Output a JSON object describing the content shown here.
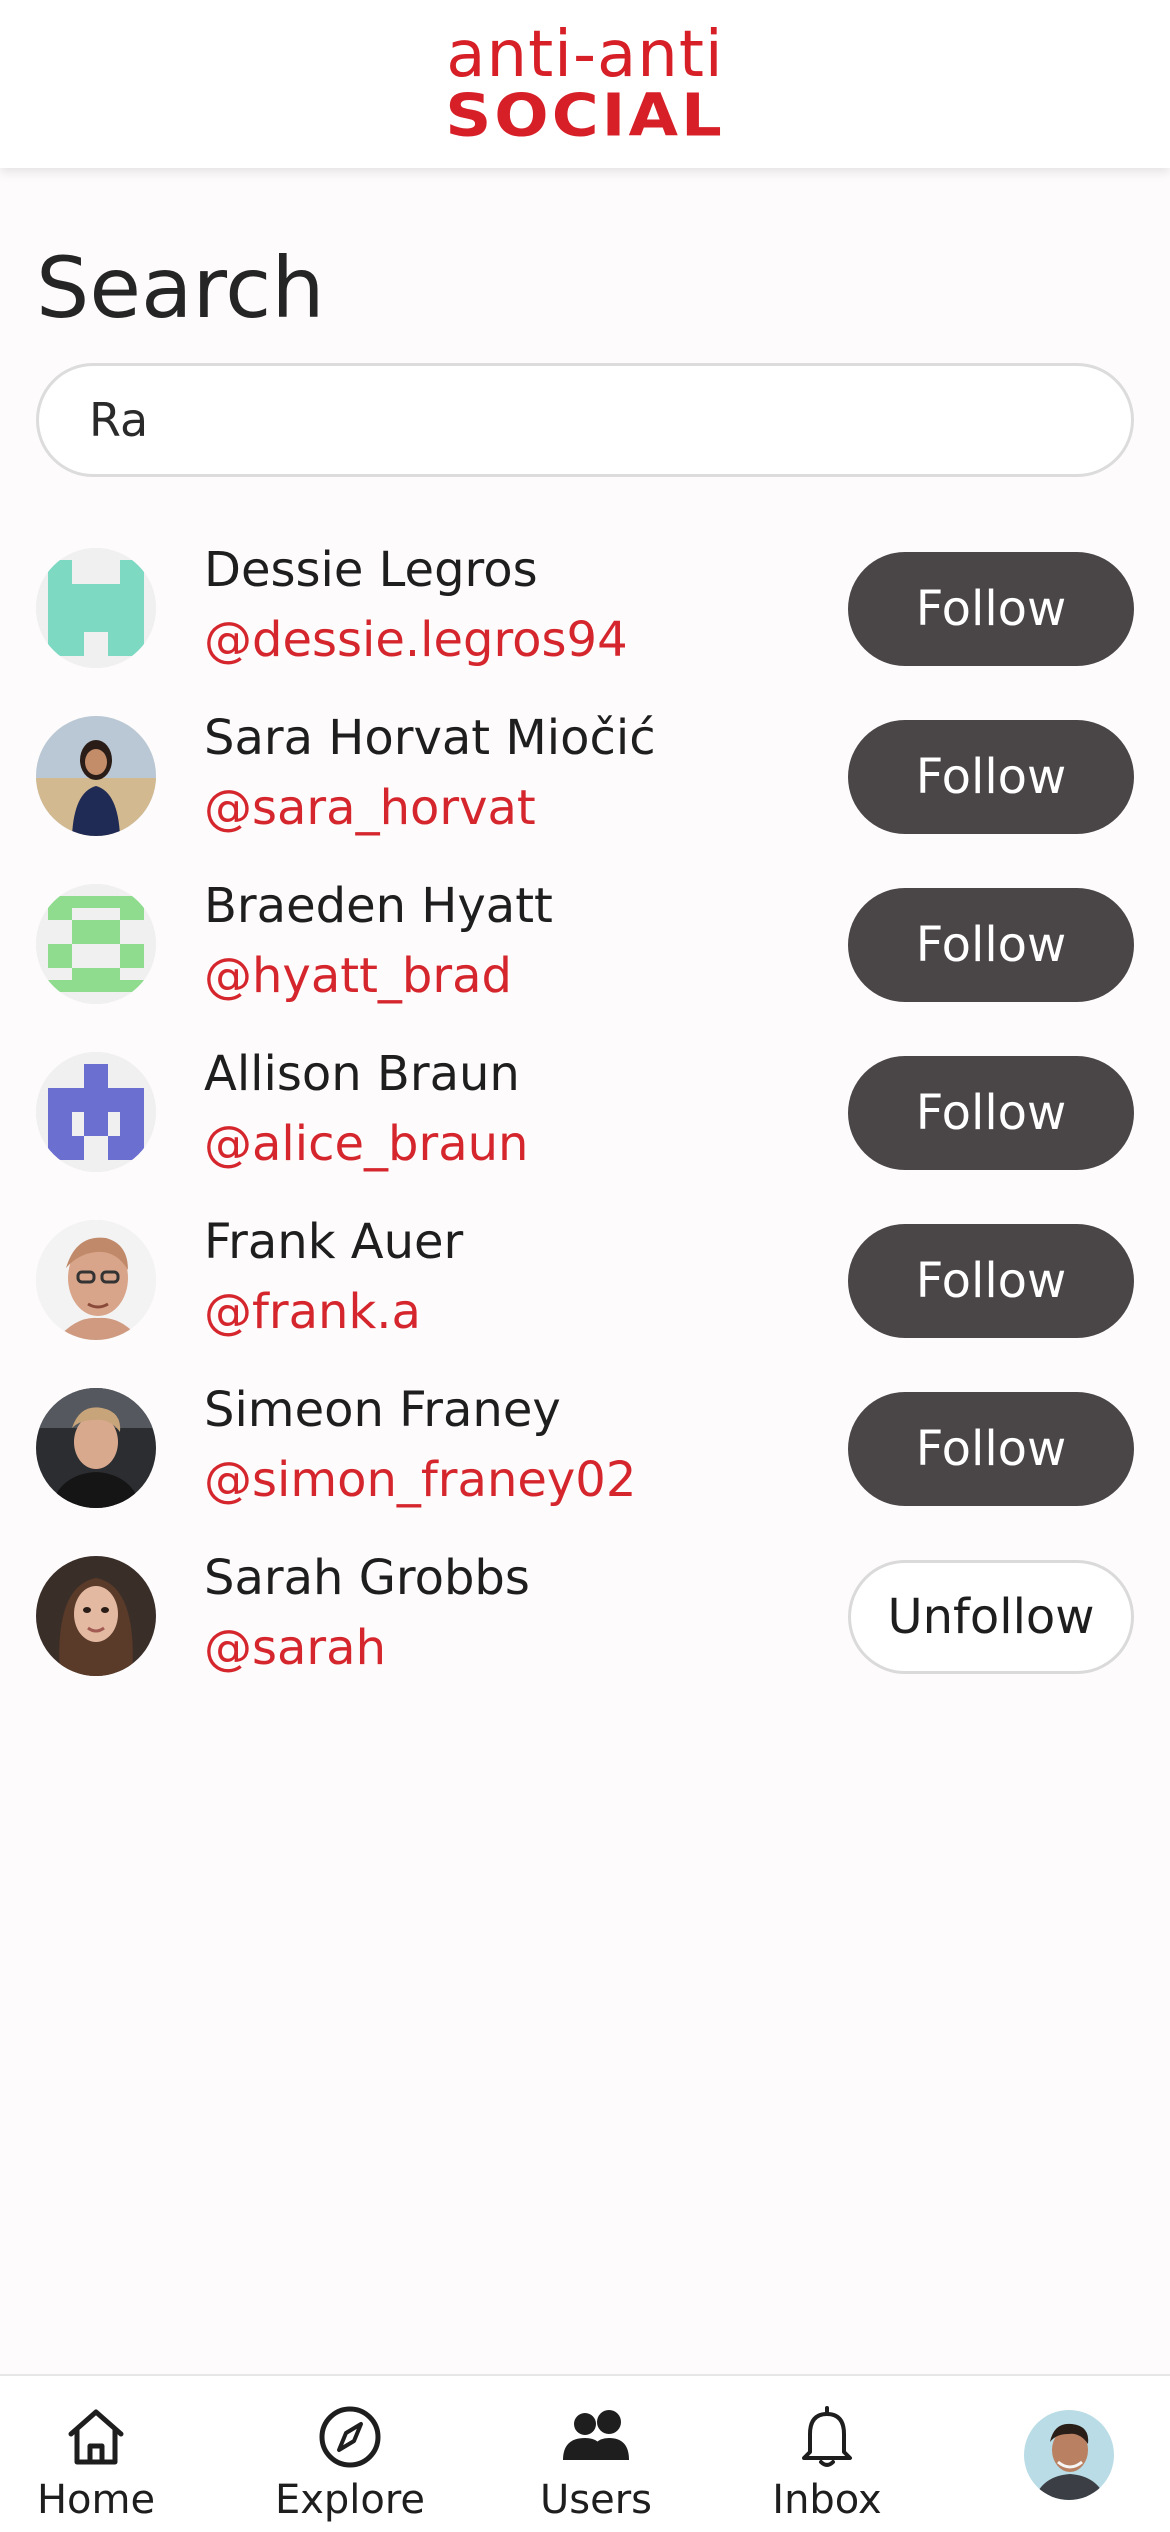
{
  "header": {
    "logo_top": "anti-anti",
    "logo_bottom": "SOCIAL",
    "brand_color": "#d71f27"
  },
  "search": {
    "title": "Search",
    "value": "Ra"
  },
  "results": [
    {
      "name": "Dessie Legros",
      "handle": "@dessie.legros94",
      "action": "Follow",
      "avatar": "identicon-teal"
    },
    {
      "name": "Sara Horvat Miočić",
      "handle": "@sara_horvat",
      "action": "Follow",
      "avatar": "photo-woman-desert"
    },
    {
      "name": "Braeden Hyatt",
      "handle": "@hyatt_brad",
      "action": "Follow",
      "avatar": "identicon-green"
    },
    {
      "name": "Allison Braun",
      "handle": "@alice_braun",
      "action": "Follow",
      "avatar": "identicon-purple"
    },
    {
      "name": "Frank Auer",
      "handle": "@frank.a",
      "action": "Follow",
      "avatar": "photo-person-glasses"
    },
    {
      "name": "Simeon Franey",
      "handle": "@simon_franey02",
      "action": "Follow",
      "avatar": "photo-man-dark"
    },
    {
      "name": "Sarah Grobbs",
      "handle": "@sarah",
      "action": "Unfollow",
      "avatar": "photo-woman-brunette"
    }
  ],
  "nav": {
    "home": "Home",
    "explore": "Explore",
    "users": "Users",
    "inbox": "Inbox",
    "profile_avatar": "photo-man-profile"
  },
  "colors": {
    "handle": "#d5262d",
    "follow_button": "#4a4647"
  }
}
